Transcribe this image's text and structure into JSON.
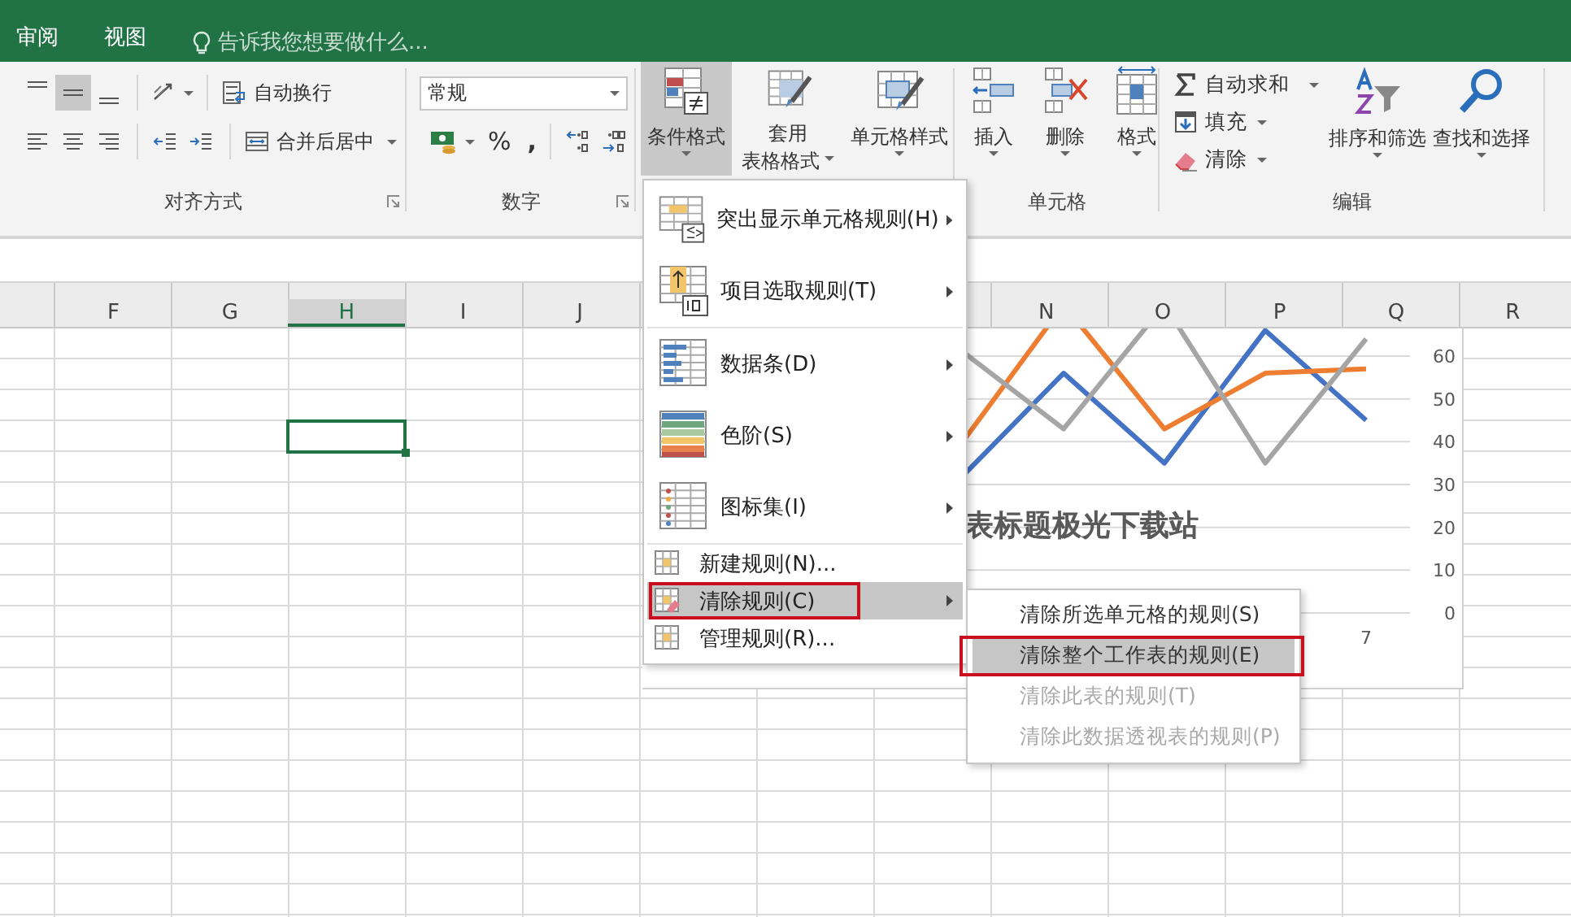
{
  "tabs": [
    {
      "label": "审阅"
    },
    {
      "label": "视图"
    }
  ],
  "tell_me": {
    "placeholder": "告诉我您想要做什么..."
  },
  "alignment": {
    "label": "对齐方式",
    "vertical_align": [
      {
        "selected": false
      },
      {
        "selected": true
      },
      {
        "selected": false
      }
    ],
    "wrap_text": "自动换行",
    "merge_center": "合并后居中"
  },
  "number": {
    "label": "数字",
    "format": "常规",
    "percent": "%",
    "comma": ","
  },
  "styles": {
    "conditional_formatting": {
      "label": "条件格式",
      "selected": true
    },
    "format_as_table": [
      "套用",
      "表格格式"
    ],
    "cell_styles": "单元格样式"
  },
  "cells": {
    "label": "单元格",
    "buttons": [
      "插入",
      "删除",
      "格式"
    ]
  },
  "editing": {
    "label": "编辑",
    "small": [
      "自动求和",
      "填充",
      "清除"
    ],
    "large": [
      "排序和筛选",
      "查找和选择"
    ]
  },
  "column_headers": {
    "left": [
      {
        "name": "F",
        "selected": false
      },
      {
        "name": "G",
        "selected": false
      },
      {
        "name": "H",
        "selected": true
      },
      {
        "name": "I",
        "selected": false
      },
      {
        "name": "J",
        "selected": false
      }
    ],
    "right": [
      {
        "name": "N",
        "selected": false
      },
      {
        "name": "O",
        "selected": false
      },
      {
        "name": "P",
        "selected": false
      },
      {
        "name": "Q",
        "selected": false
      },
      {
        "name": "R",
        "selected": false
      }
    ]
  },
  "chart": {
    "title": "表标题极光下载站",
    "y_labels": [
      "60",
      "50",
      "40",
      "30",
      "20",
      "10",
      "0"
    ],
    "x_label": "7",
    "series": [
      {
        "color": "#4472c4"
      },
      {
        "color": "#ed7d31"
      },
      {
        "color": "#a5a5a5"
      }
    ]
  },
  "menu": {
    "sections": [
      [
        {
          "kind": "large",
          "label": "突出显示单元格规则(H)",
          "submenu": true,
          "highlighted": false,
          "outlined": false
        },
        {
          "kind": "large",
          "label": "项目选取规则(T)",
          "submenu": true,
          "highlighted": false,
          "outlined": false
        }
      ],
      [
        {
          "kind": "large",
          "label": "数据条(D)",
          "submenu": true,
          "highlighted": false,
          "outlined": false
        },
        {
          "kind": "large",
          "label": "色阶(S)",
          "submenu": true,
          "highlighted": false,
          "outlined": false
        },
        {
          "kind": "large",
          "label": "图标集(I)",
          "submenu": true,
          "highlighted": false,
          "outlined": false
        }
      ],
      [
        {
          "kind": "small",
          "label": "新建规则(N)...",
          "submenu": false,
          "highlighted": false,
          "outlined": false
        },
        {
          "kind": "small",
          "label": "清除规则(C)",
          "submenu": true,
          "highlighted": true,
          "outlined": true
        },
        {
          "kind": "small",
          "label": "管理规则(R)...",
          "submenu": false,
          "highlighted": false,
          "outlined": false
        }
      ]
    ]
  },
  "submenu": {
    "items": [
      {
        "label": "清除所选单元格的规则(S)",
        "disabled": false,
        "highlighted": false,
        "outlined": false
      },
      {
        "label": "清除整个工作表的规则(E)",
        "disabled": false,
        "highlighted": true,
        "outlined": true
      },
      {
        "label": "清除此表的规则(T)",
        "disabled": true,
        "highlighted": false,
        "outlined": false
      },
      {
        "label": "清除此数据透视表的规则(P)",
        "disabled": true,
        "highlighted": false,
        "outlined": false
      }
    ]
  }
}
